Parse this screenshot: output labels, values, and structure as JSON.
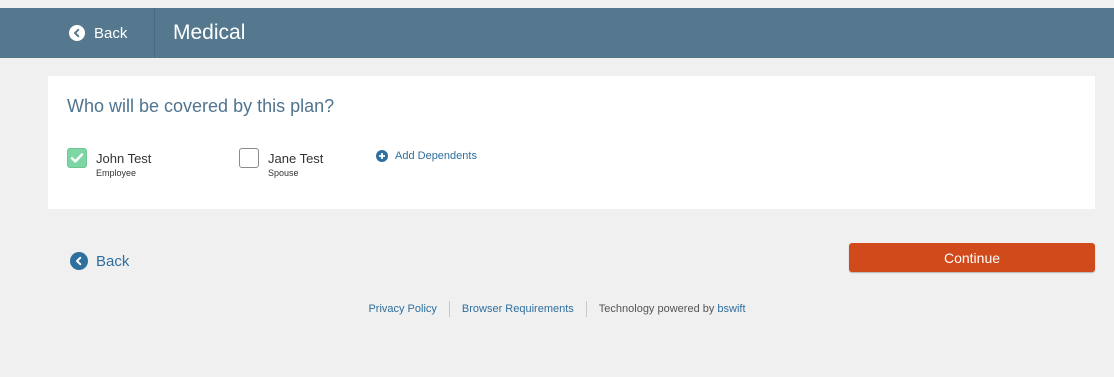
{
  "header": {
    "back_label": "Back",
    "title": "Medical"
  },
  "main": {
    "question": "Who will be covered by this plan?",
    "people": [
      {
        "name": "John Test",
        "role": "Employee",
        "checked": true
      },
      {
        "name": "Jane Test",
        "role": "Spouse",
        "checked": false
      }
    ],
    "add_dependents_label": "Add Dependents"
  },
  "nav": {
    "back_label": "Back",
    "continue_label": "Continue"
  },
  "footer": {
    "privacy_policy": "Privacy Policy",
    "browser_requirements": "Browser Requirements",
    "powered_by_prefix": "Technology powered by",
    "powered_by_brand": "bswift"
  },
  "colors": {
    "header_bar": "#55788f",
    "accent_link": "#2f6f9e",
    "continue_button": "#d14a1b",
    "checkbox_checked": "#7ed6a4"
  },
  "icons": {
    "back": "chevron-left-circle-icon",
    "add": "plus-circle-icon",
    "check": "checkmark-icon"
  }
}
